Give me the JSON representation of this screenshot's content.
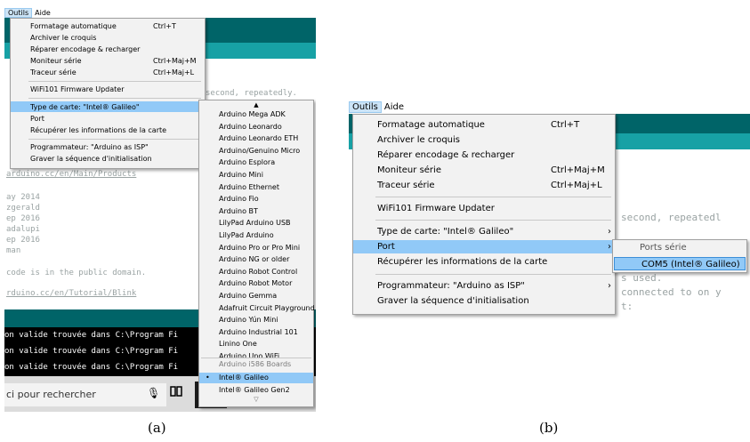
{
  "left": {
    "menubar": {
      "outils": "Outils",
      "aide": "Aide"
    },
    "menu": [
      {
        "label": "Formatage automatique",
        "shortcut": "Ctrl+T"
      },
      {
        "label": "Archiver le croquis",
        "shortcut": ""
      },
      {
        "label": "Réparer encodage & recharger",
        "shortcut": ""
      },
      {
        "label": "Moniteur série",
        "shortcut": "Ctrl+Maj+M"
      },
      {
        "label": "Traceur série",
        "shortcut": "Ctrl+Maj+L"
      },
      {
        "label": "WiFi101 Firmware Updater",
        "shortcut": ""
      },
      {
        "label": "Type de carte: \"Intel® Galileo\"",
        "shortcut": ""
      },
      {
        "label": "Port",
        "shortcut": ""
      },
      {
        "label": "Récupérer les informations de la carte",
        "shortcut": ""
      },
      {
        "label": "Programmateur: \"Arduino as ISP\"",
        "shortcut": ""
      },
      {
        "label": "Graver la séquence d'initialisation",
        "shortcut": ""
      }
    ],
    "boards": [
      "Arduino Mega ADK",
      "Arduino Leonardo",
      "Arduino Leonardo ETH",
      "Arduino/Genuino Micro",
      "Arduino Esplora",
      "Arduino Mini",
      "Arduino Ethernet",
      "Arduino Fio",
      "Arduino BT",
      "LilyPad Arduino USB",
      "LilyPad Arduino",
      "Arduino Pro or Pro Mini",
      "Arduino NG or older",
      "Arduino Robot Control",
      "Arduino Robot Motor",
      "Arduino Gemma",
      "Adafruit Circuit Playground",
      "Arduino Yún Mini",
      "Arduino Industrial 101",
      "Linino One",
      "Arduino Uno WiFi"
    ],
    "boards_section": "Arduino i586 Boards",
    "selected_board": "Intel® Galileo",
    "board_gen2": "Intel® Galileo Gen2",
    "code_lines": [
      "second, repeatedly.",
      "arduino.cc/en/Main/Products",
      "ay 2014",
      "zgerald",
      "ep 2016",
      "adalupi",
      "ep 2016",
      "man",
      "code is in the public domain.",
      "rduino.cc/en/Tutorial/Blink"
    ],
    "console_lines": [
      "on valide trouvée dans C:\\Program Fi",
      "on valide trouvée dans C:\\Program Fi",
      "on valide trouvée dans C:\\Program Fi"
    ],
    "search_placeholder": "ci pour rechercher",
    "caption": "(a)"
  },
  "right": {
    "menubar": {
      "outils": "Outils",
      "aide": "Aide"
    },
    "menu": [
      {
        "label": "Formatage automatique",
        "shortcut": "Ctrl+T"
      },
      {
        "label": "Archiver le croquis",
        "shortcut": ""
      },
      {
        "label": "Réparer encodage & recharger",
        "shortcut": ""
      },
      {
        "label": "Moniteur série",
        "shortcut": "Ctrl+Maj+M"
      },
      {
        "label": "Traceur série",
        "shortcut": "Ctrl+Maj+L"
      },
      {
        "label": "WiFi101 Firmware Updater",
        "shortcut": ""
      },
      {
        "label": "Type de carte: \"Intel® Galileo\"",
        "shortcut": ""
      },
      {
        "label": "Port",
        "shortcut": ""
      },
      {
        "label": "Récupérer les informations de la carte",
        "shortcut": ""
      },
      {
        "label": "Programmateur: \"Arduino as ISP\"",
        "shortcut": ""
      },
      {
        "label": "Graver la séquence d'initialisation",
        "shortcut": ""
      }
    ],
    "ports_header": "Ports série",
    "port_item": "COM5 (Intel® Galileo)",
    "code_lines": [
      "second, repeatedl",
      "s used.",
      "connected to on y",
      "t:"
    ],
    "caption": "(b)"
  }
}
